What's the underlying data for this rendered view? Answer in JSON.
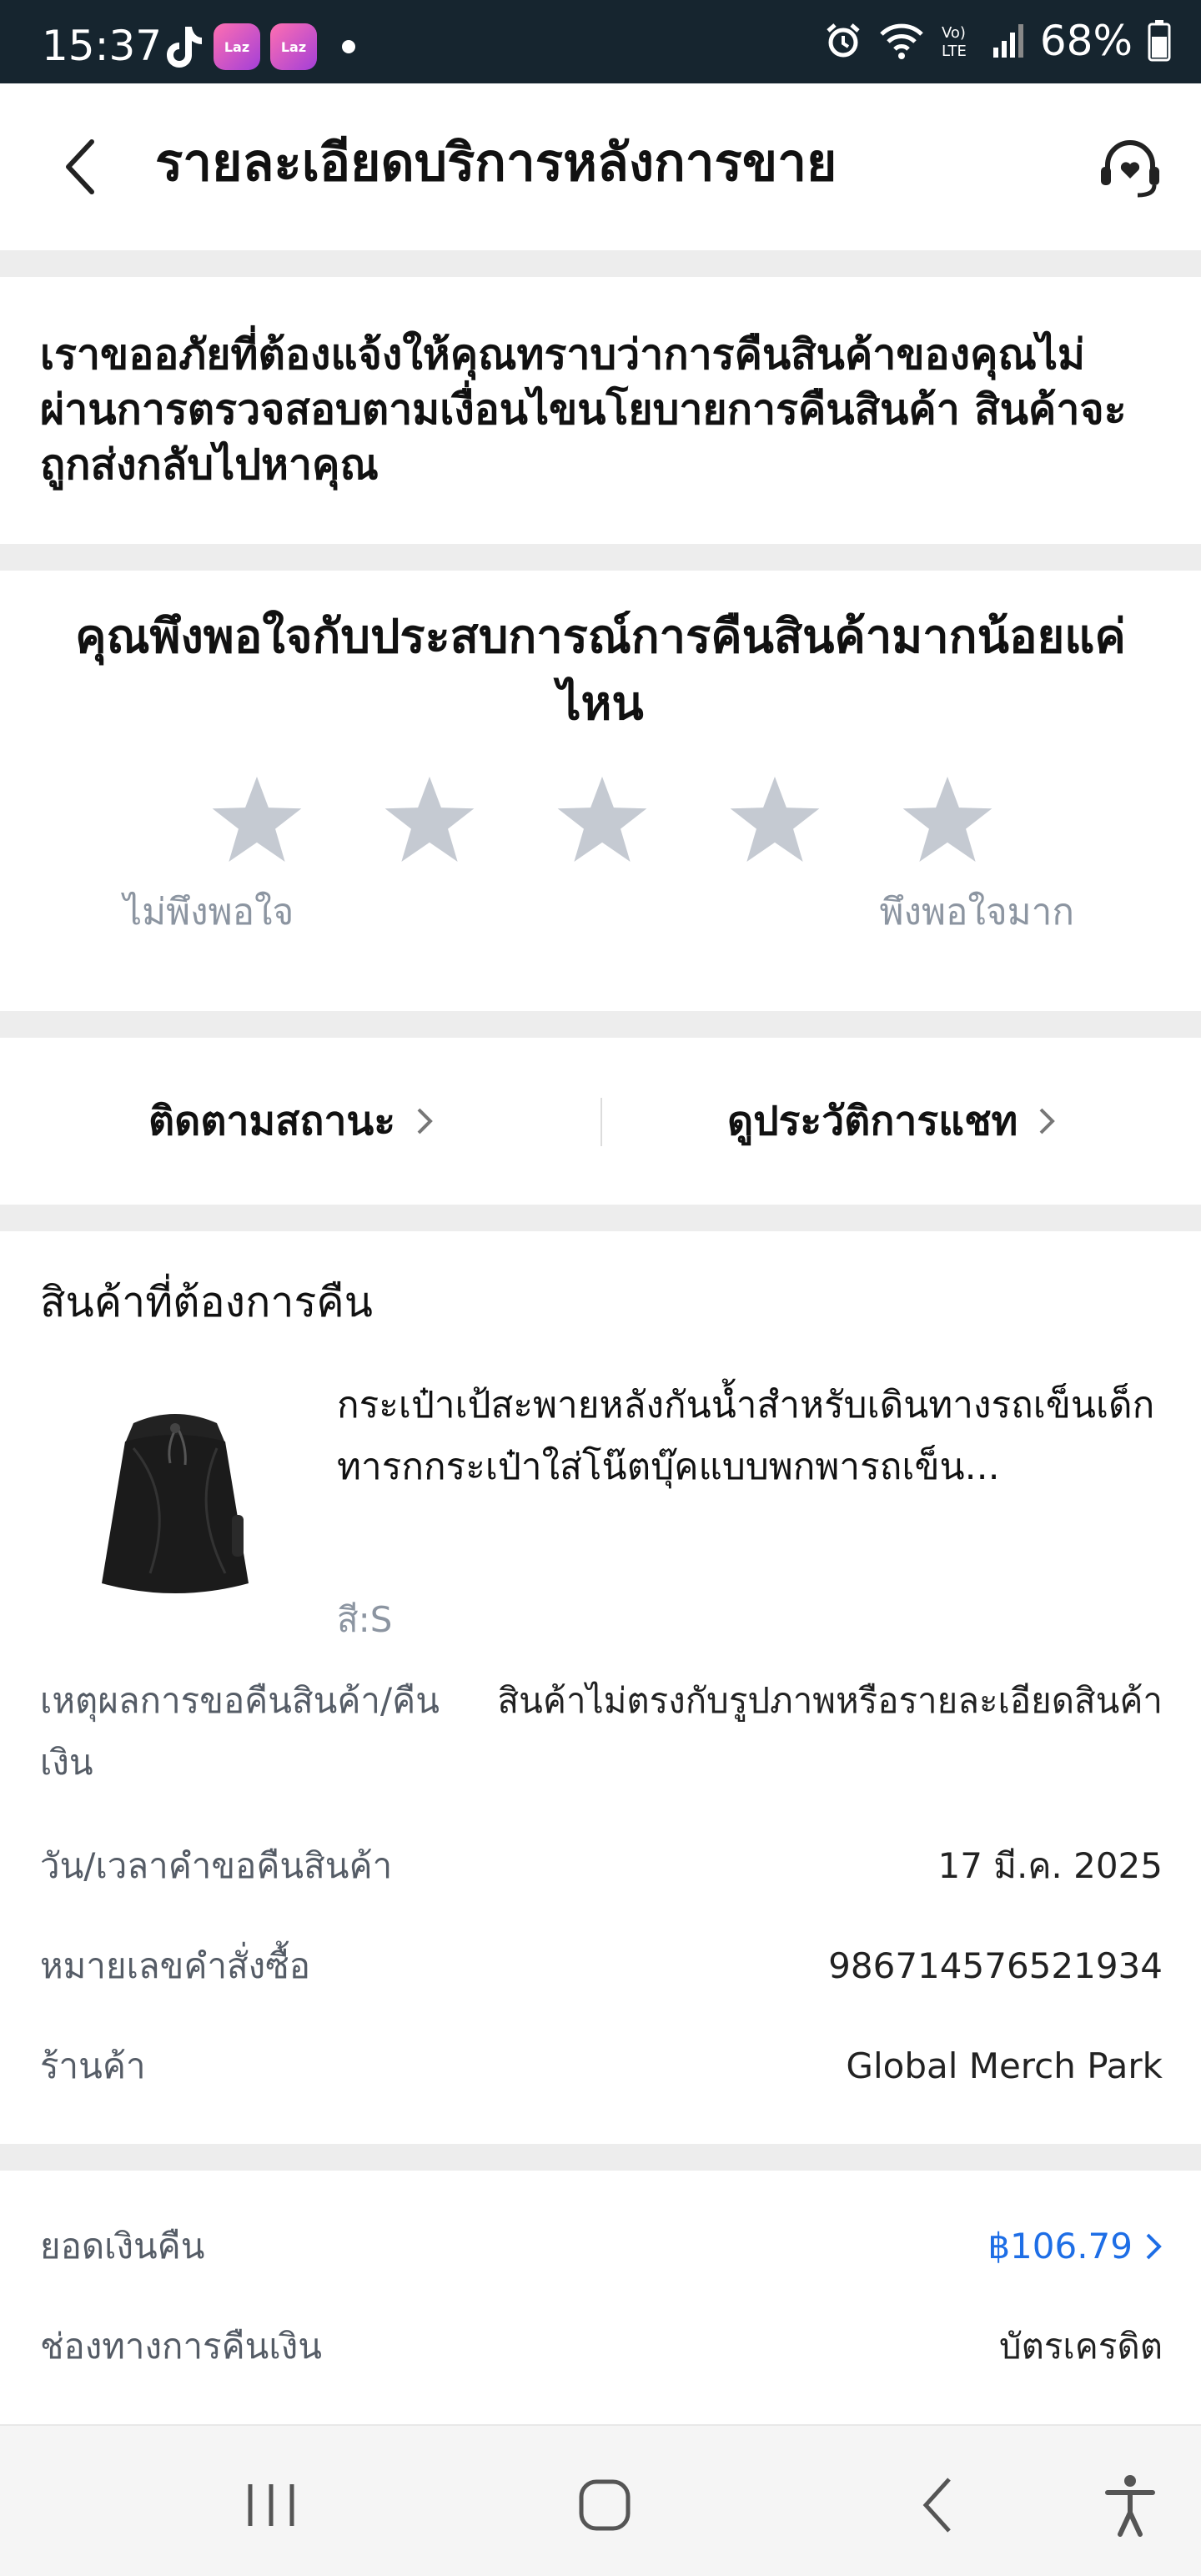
{
  "status_bar": {
    "time": "15:37",
    "battery": "68%",
    "app_badges": [
      "Laz",
      "Laz"
    ]
  },
  "header": {
    "title": "รายละเอียดบริการหลังการขาย"
  },
  "notice": {
    "text": "เราขออภัยที่ต้องแจ้งให้คุณทราบว่าการคืนสินค้าของคุณไม่ผ่านการตรวจสอบตามเงื่อนไขนโยบายการคืนสินค้า สินค้าจะถูกส่งกลับไปหาคุณ"
  },
  "rating": {
    "question": "คุณพึงพอใจกับประสบการณ์การคืนสินค้ามากน้อยแค่ไหน",
    "low_label": "ไม่พึงพอใจ",
    "high_label": "พึงพอใจมาก",
    "stars_total": 5,
    "stars_selected": 0,
    "star_color": "#c5cad2"
  },
  "links": {
    "track_status": "ติดตามสถานะ",
    "chat_history": "ดูประวัติการแชท"
  },
  "product_section": {
    "title": "สินค้าที่ต้องการคืน",
    "product_name": "กระเป๋าเป้สะพายหลังกันน้ำสำหรับเดินทางรถเข็นเด็กทารกกระเป๋าใส่โน๊ตบุ๊คแบบพกพารถเข็น...",
    "variant": "สี:S",
    "rows": [
      {
        "label": "เหตุผลการขอคืนสินค้า/คืนเงิน",
        "value": "สินค้าไม่ตรงกับรูปภาพหรือรายละเอียดสินค้า"
      },
      {
        "label": "วัน/เวลาคำขอคืนสินค้า",
        "value": "17 มี.ค. 2025"
      },
      {
        "label": "หมายเลขคำสั่งซื้อ",
        "value": "986714576521934"
      },
      {
        "label": "ร้านค้า",
        "value": "Global Merch Park"
      }
    ]
  },
  "refund": {
    "amount_label": "ยอดเงินคืน",
    "amount_value": "฿106.79",
    "method_label": "ช่องทางการคืนเงิน",
    "method_value": "บัตรเครดิต",
    "accent_color": "#1e6ee6"
  }
}
